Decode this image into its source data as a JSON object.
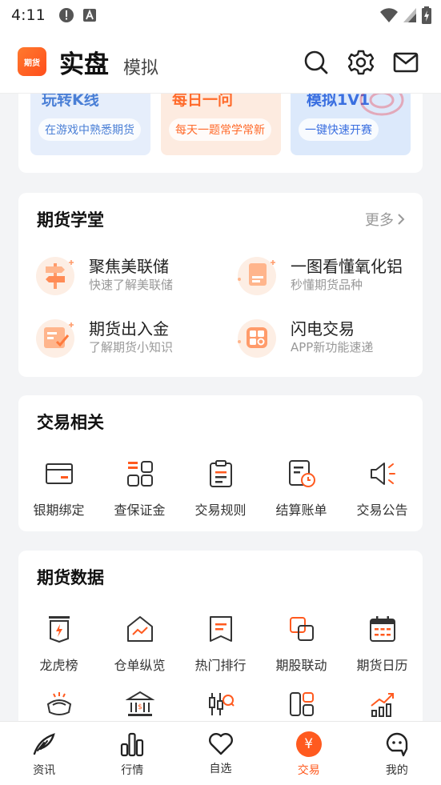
{
  "status": {
    "time": "4:11"
  },
  "header": {
    "logo_text": "期货",
    "title": "实盘",
    "subtitle": "模拟"
  },
  "promos": [
    {
      "title": "玩转K线",
      "pill": "在游戏中熟悉期货",
      "color": "#4a7fd6",
      "bg": "#e8f0fc"
    },
    {
      "title": "每日一问",
      "pill": "每天一题常学常新",
      "color": "#ff6a2a",
      "bg": "#fff0e6"
    },
    {
      "title": "模拟1V1",
      "pill": "一键快速开赛",
      "color": "#3a6fe0",
      "bg": "#e4eefc"
    }
  ],
  "school": {
    "title": "期货学堂",
    "more": "更多",
    "lessons": [
      {
        "title": "聚焦美联储",
        "sub": "快速了解美联储"
      },
      {
        "title": "一图看懂氧化铝",
        "sub": "秒懂期货品种"
      },
      {
        "title": "期货出入金",
        "sub": "了解期货小知识"
      },
      {
        "title": "闪电交易",
        "sub": "APP新功能速递"
      }
    ]
  },
  "trade": {
    "title": "交易相关",
    "items": [
      "银期绑定",
      "查保证金",
      "交易规则",
      "结算账单",
      "交易公告"
    ]
  },
  "data": {
    "title": "期货数据",
    "items": [
      "龙虎榜",
      "仓单纵览",
      "热门排行",
      "期股联动",
      "期货日历"
    ]
  },
  "tabs": [
    "资讯",
    "行情",
    "自选",
    "交易",
    "我的"
  ],
  "tab_active_symbol": "¥",
  "colors": {
    "accent": "#ff5a1f"
  }
}
